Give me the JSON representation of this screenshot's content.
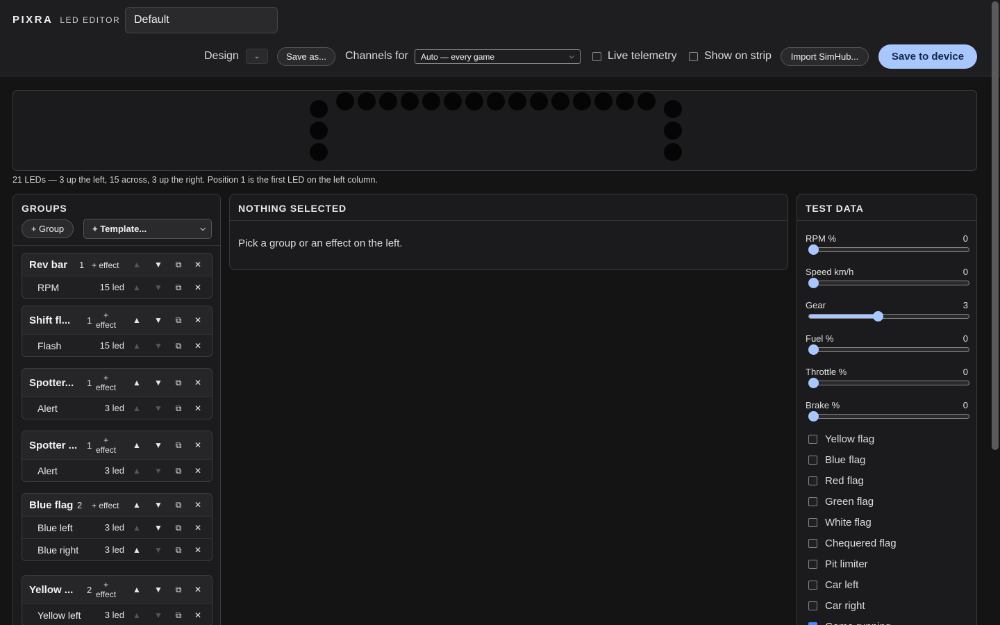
{
  "brand": {
    "name": "PIXRA",
    "sub": "LED EDITOR"
  },
  "preset_name": "Default",
  "toolbar": {
    "design_label": "Design",
    "save_as": "Save as...",
    "channels_label": "Channels for",
    "channels_value": "Auto — every game",
    "live_telemetry": "Live telemetry",
    "show_on_strip": "Show on strip",
    "import": "Import SimHub...",
    "save_device": "Save to device"
  },
  "strip_caption": "21 LEDs — 3 up the left, 15 across, 3 up the right. Position 1 is the first LED on the left column.",
  "groups_panel": {
    "title": "GROUPS",
    "add_group": "+ Group",
    "template": "+ Template...",
    "groups": [
      {
        "name": "Rev bar",
        "count": "1",
        "effect": "+ effect",
        "rows": [
          {
            "name": "RPM",
            "led": "15 led"
          }
        ]
      },
      {
        "name": "Shift fl...",
        "count": "1",
        "effect": "+\neffect",
        "rows": [
          {
            "name": "Flash",
            "led": "15 led"
          }
        ]
      },
      {
        "name": "Spotter...",
        "count": "1",
        "effect": "+\neffect",
        "rows": [
          {
            "name": "Alert",
            "led": "3 led"
          }
        ]
      },
      {
        "name": "Spotter ...",
        "count": "1",
        "effect": "+\neffect",
        "rows": [
          {
            "name": "Alert",
            "led": "3 led"
          }
        ]
      },
      {
        "name": "Blue flag",
        "count": "2",
        "effect": "+ effect",
        "rows": [
          {
            "name": "Blue left",
            "led": "3 led"
          },
          {
            "name": "Blue right",
            "led": "3 led"
          }
        ]
      },
      {
        "name": "Yellow ...",
        "count": "2",
        "effect": "+\neffect",
        "rows": [
          {
            "name": "Yellow left",
            "led": "3 led"
          }
        ]
      }
    ]
  },
  "detail": {
    "title": "NOTHING SELECTED",
    "message": "Pick a group or an effect on the left."
  },
  "test_data": {
    "title": "TEST DATA",
    "sliders": [
      {
        "label": "RPM %",
        "value": "0",
        "fraction": 0
      },
      {
        "label": "Speed km/h",
        "value": "0",
        "fraction": 0
      },
      {
        "label": "Gear",
        "value": "3",
        "fraction": 0.43
      },
      {
        "label": "Fuel %",
        "value": "0",
        "fraction": 0
      },
      {
        "label": "Throttle %",
        "value": "0",
        "fraction": 0
      },
      {
        "label": "Brake %",
        "value": "0",
        "fraction": 0
      }
    ],
    "flags": [
      {
        "label": "Yellow flag",
        "checked": false
      },
      {
        "label": "Blue flag",
        "checked": false
      },
      {
        "label": "Red flag",
        "checked": false
      },
      {
        "label": "Green flag",
        "checked": false
      },
      {
        "label": "White flag",
        "checked": false
      },
      {
        "label": "Chequered flag",
        "checked": false
      },
      {
        "label": "Pit limiter",
        "checked": false
      },
      {
        "label": "Car left",
        "checked": false
      },
      {
        "label": "Car right",
        "checked": false
      },
      {
        "label": "Game running",
        "checked": true
      }
    ]
  },
  "colors": {
    "accent": "#a9c7ff",
    "bg": "#141414",
    "panel": "#1b1b1d"
  }
}
